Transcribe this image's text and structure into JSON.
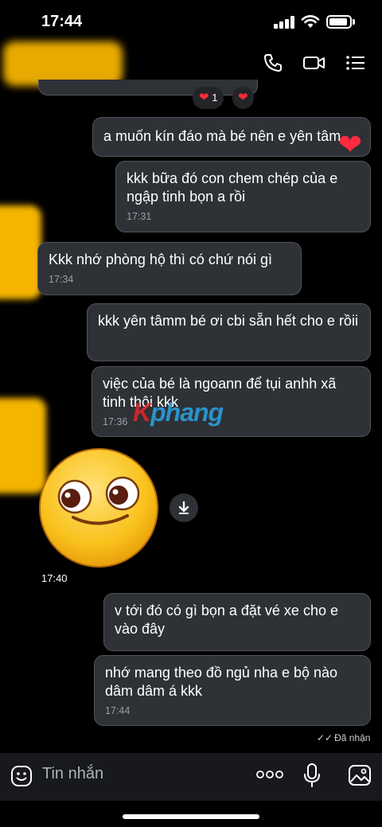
{
  "status_bar": {
    "time": "17:44"
  },
  "header": {
    "call_icon": "phone-icon",
    "video_icon": "video-camera-icon",
    "menu_icon": "list-menu-icon"
  },
  "reactions": {
    "count": "1"
  },
  "messages": [
    {
      "text": "a muốn kín đáo mà bé nên e yên tâm",
      "time": ""
    },
    {
      "text": "kkk bữa đó con chem chép của e ngập tinh bọn a rồi",
      "time": "17:31"
    },
    {
      "text": "Kkk nhớ phòng hộ thì có chứ nói gì",
      "time": "17:34"
    },
    {
      "text": "kkk yên tâmm bé ơi cbi sẵn hết cho e rồii",
      "time": ""
    },
    {
      "text": "việc của bé là ngoann để tụi anhh xã tinh thôi kkk",
      "time": "17:36"
    },
    {
      "text": "v tới đó có gì bọn a đặt vé xe cho e vào đây",
      "time": ""
    },
    {
      "text": "nhớ mang theo đồ ngủ nha e bộ nào dâm dâm á kkk",
      "time": "17:44"
    }
  ],
  "watermark": {
    "part1": "K",
    "part2": "phang"
  },
  "sticker": {
    "time": "17:40"
  },
  "status": {
    "delivered": "Đã nhận"
  },
  "composer": {
    "placeholder": "Tin nhắn"
  }
}
